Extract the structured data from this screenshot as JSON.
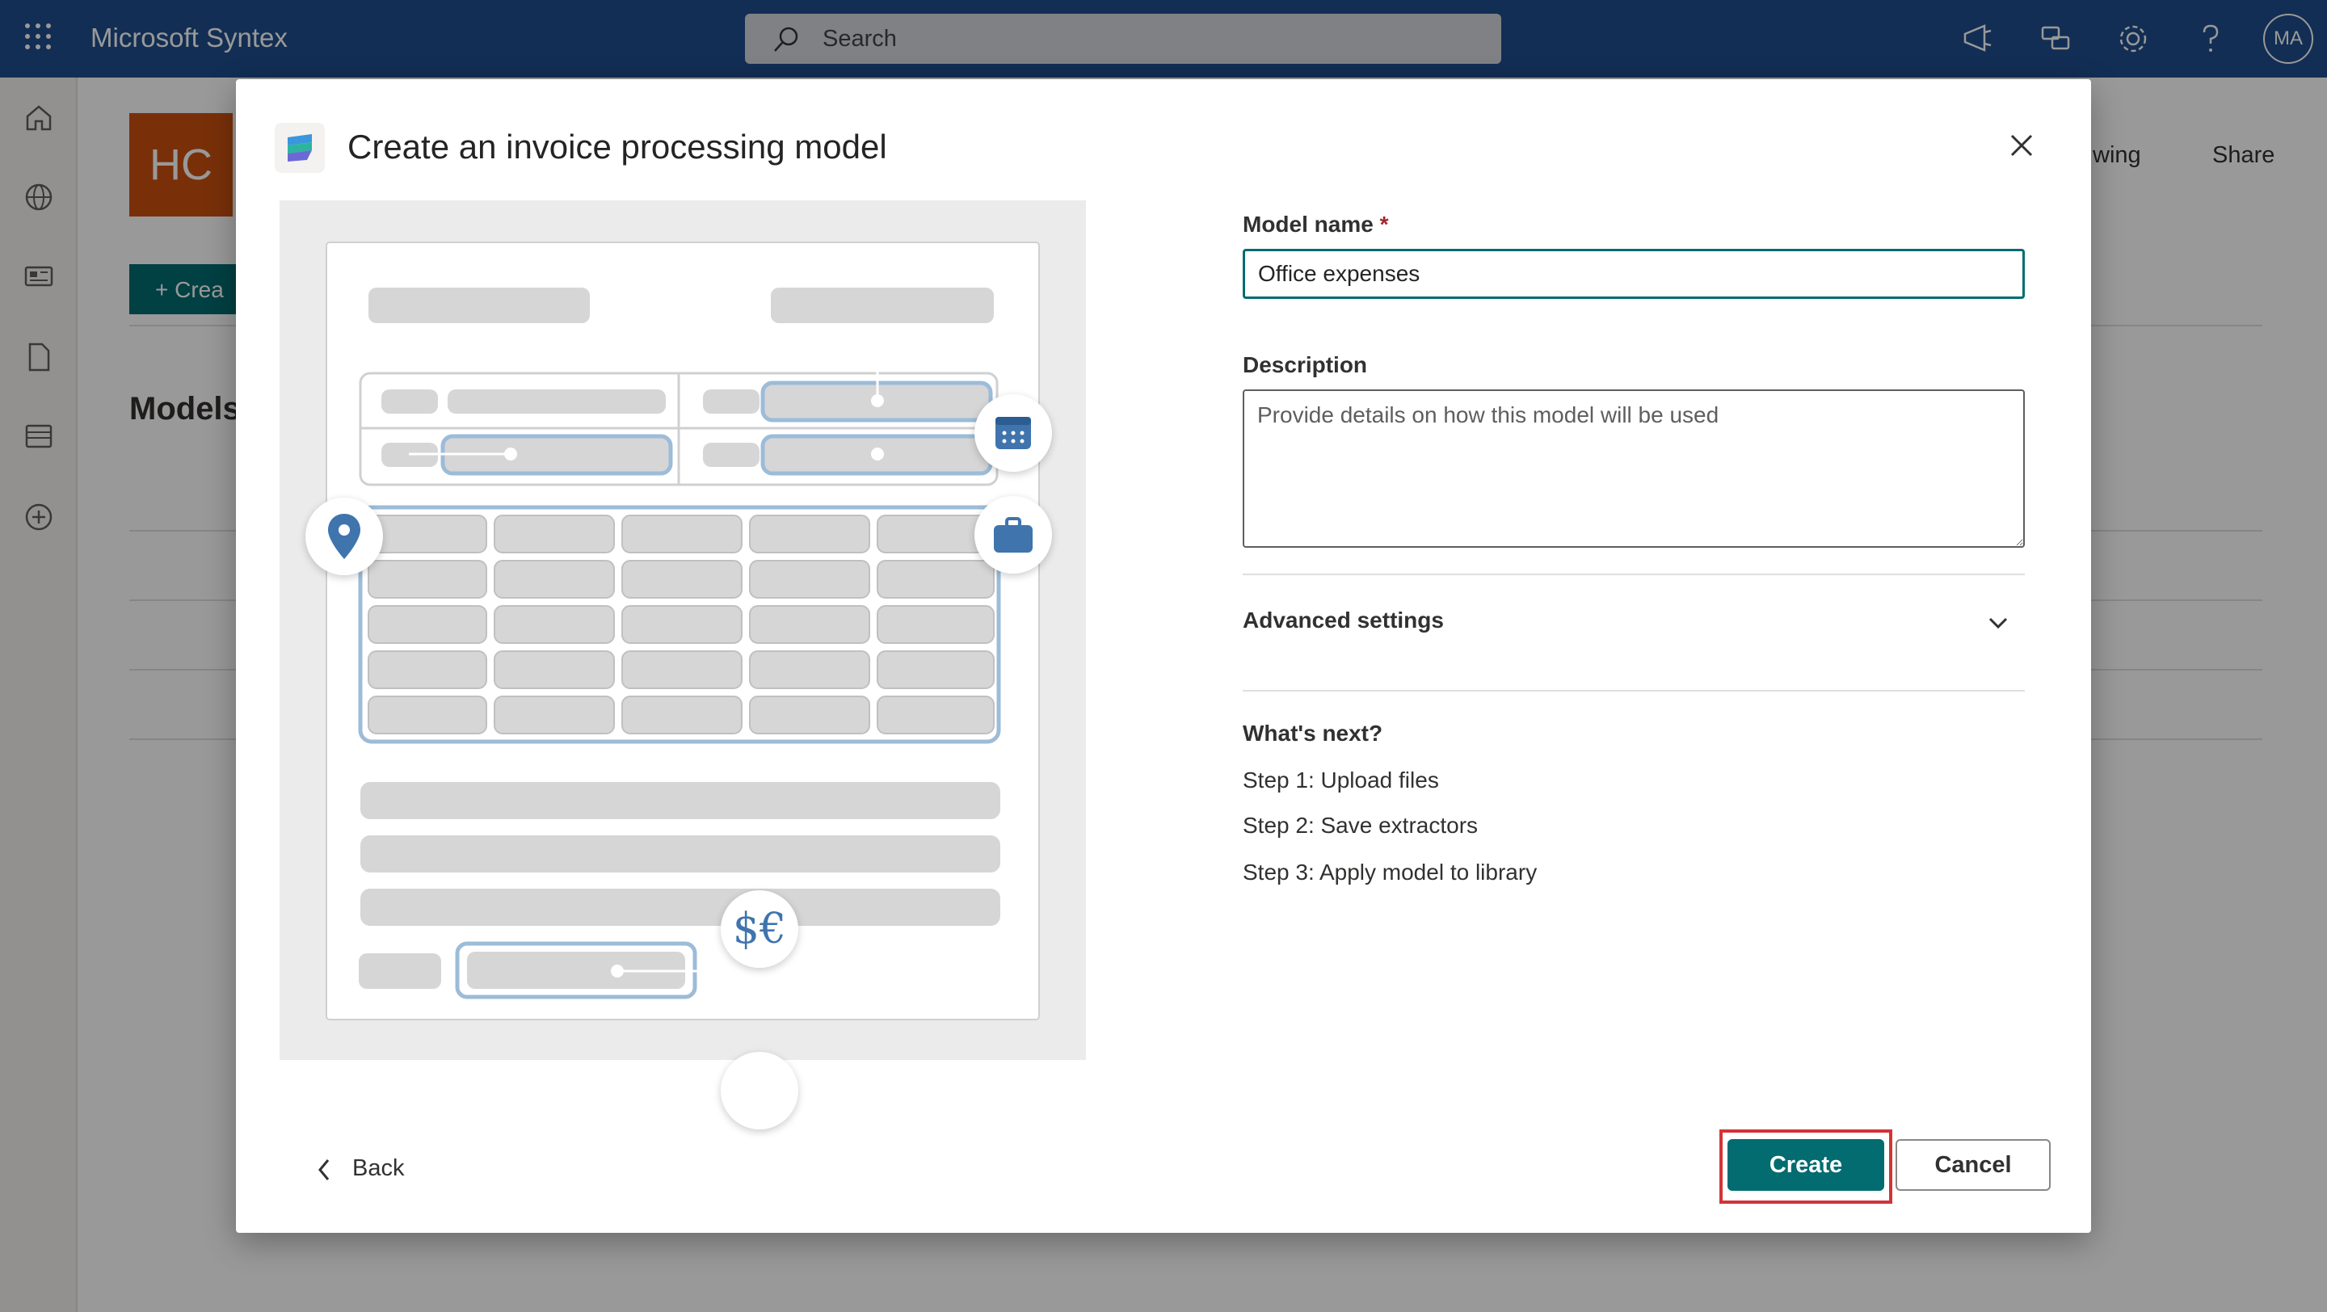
{
  "topbar": {
    "app_title": "Microsoft Syntex",
    "search_placeholder": "Search",
    "avatar_initials": "MA",
    "icons": [
      "waffle-icon",
      "megaphone-icon",
      "people-chat-icon",
      "gear-icon",
      "help-icon"
    ]
  },
  "rail": {
    "icons": [
      "home-icon",
      "globe-icon",
      "news-icon",
      "document-icon",
      "list-icon",
      "add-circle-icon"
    ]
  },
  "background_page": {
    "site_initials": "HC",
    "share_label": "Share",
    "following_partial": "wing",
    "create_partial": "+ Crea",
    "models_partial": "Models"
  },
  "dialog": {
    "title": "Create an invoice processing model",
    "model_name": {
      "label": "Model name",
      "required_mark": "*",
      "value": "Office expenses"
    },
    "description": {
      "label": "Description",
      "placeholder": "Provide details on how this model will be used"
    },
    "advanced_settings": "Advanced settings",
    "whats_next": {
      "title": "What's next?",
      "steps": [
        "Step 1: Upload files",
        "Step 2: Save extractors",
        "Step 3: Apply model to library"
      ]
    },
    "back_label": "Back",
    "create_label": "Create",
    "cancel_label": "Cancel",
    "illustration": {
      "currency_symbol": "$€",
      "icons": [
        "calendar-icon",
        "location-pin-icon",
        "briefcase-icon",
        "currency-icon"
      ]
    }
  },
  "colors": {
    "topbar": "#1f4e8c",
    "primary": "#036c70",
    "highlight": "#d13438",
    "illustration_accent": "#9cbcd8"
  }
}
